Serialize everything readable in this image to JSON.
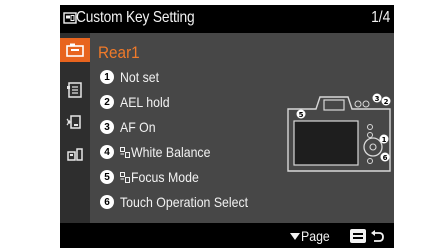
{
  "title": "Custom Key Setting",
  "page_indicator": "1/4",
  "sidebar": {
    "tabs": [
      {
        "icon": "camera-tab-icon",
        "active": true
      },
      {
        "icon": "playback-tab-icon",
        "active": false
      },
      {
        "icon": "network-tab-icon",
        "active": false
      },
      {
        "icon": "setup-tab-icon",
        "active": false
      }
    ]
  },
  "section_title": "Rear1",
  "items": [
    {
      "number": "1",
      "label": "Not set",
      "fn_icon": false
    },
    {
      "number": "2",
      "label": "AEL hold",
      "fn_icon": false
    },
    {
      "number": "3",
      "label": "AF On",
      "fn_icon": false
    },
    {
      "number": "4",
      "label": "White Balance",
      "fn_icon": true
    },
    {
      "number": "5",
      "label": "Focus Mode",
      "fn_icon": true
    },
    {
      "number": "6",
      "label": "Touch Operation Select",
      "fn_icon": false
    }
  ],
  "camera_diagram": {
    "callouts": [
      "1",
      "2",
      "3",
      "5",
      "6"
    ]
  },
  "footer": {
    "page_label": "Page",
    "page_icon": "triangle-down-icon",
    "back_icon": "menu-return-icon"
  },
  "colors": {
    "accent": "#e8641e",
    "section_title": "#f07a2a",
    "panel": "#474747",
    "sidebar": "#2e2e2e",
    "bars": "#000000"
  }
}
